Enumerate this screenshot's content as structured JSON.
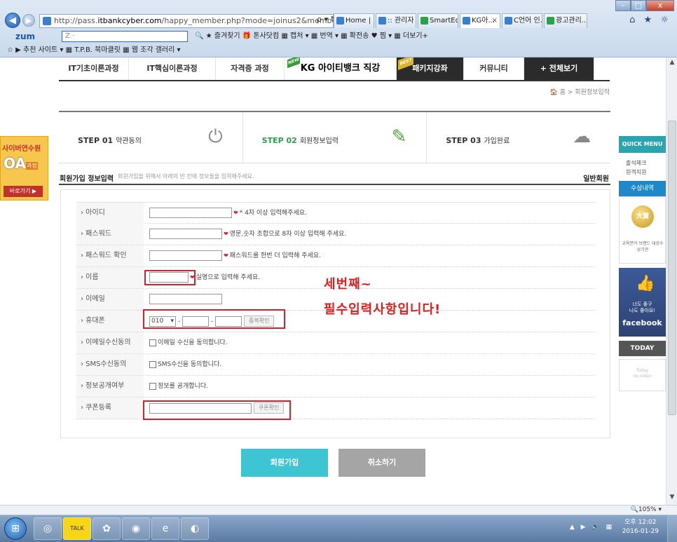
{
  "browser": {
    "url_prefix": "http://pass.",
    "url_host": "itbankcyber.com",
    "url_path": "/happy_member.php?mode=joinus2&member_group=1",
    "addr_tools": "ρ ▾ ↻",
    "tabs": [
      {
        "label": "Home | L...",
        "color": "#3a7fd0",
        "active": false
      },
      {
        "label": ":: 관리자 ...",
        "color": "#3a7fd0",
        "active": false
      },
      {
        "label": "SmartEdit...",
        "color": "#2ea04a",
        "active": false
      },
      {
        "label": "KG아...",
        "color": "#3a7fd0",
        "active": true
      },
      {
        "label": "C언어 인...",
        "color": "#3a7fd0",
        "active": false
      },
      {
        "label": "광고관리...",
        "color": "#2ea04a",
        "active": false
      }
    ],
    "win_min": "–",
    "win_max": "□",
    "win_close": "x",
    "home_star_gear": "⌂ ★ ☼",
    "zum_label": "zum",
    "zum_search_placeholder": "Z ·",
    "toolbar_items": "🔍 ★ 즐겨찾기   🎁 톤사닷컴   ▦ 캡처 ▾   ▦ 번역 ▾   ▦ 확전송   ♥ 찜 ▾   ▦ 더보기+",
    "bookmarks": "☆ ▶ 추천 사이트 ▾   ▦ T.P.B. 북마클릿   ▦ 웹 조각 갤러리 ▾",
    "zoom": "🔍105%  ▾"
  },
  "nav": {
    "items": [
      {
        "label": "IT기초이론과정",
        "width": 100
      },
      {
        "label": "IT핵심이론과정",
        "width": 124
      },
      {
        "label": "자격증 과정",
        "width": 98
      },
      {
        "label": "KG 아이티뱅크 직강",
        "width": 160
      },
      {
        "label": "패키지강좌",
        "width": 96
      },
      {
        "label": "커뮤니티",
        "width": 86
      },
      {
        "label": "+ 전체보기",
        "width": 100
      }
    ],
    "new_badge": "NEW",
    "best_badge": "BEST"
  },
  "breadcrumb": "🏠 홈 > 회원정보입력",
  "steps": [
    {
      "num": "STEP 01",
      "name": "약관동의",
      "icon": "⏻",
      "active": false
    },
    {
      "num": "STEP 02",
      "name": "회원정보입력",
      "icon": "✎",
      "active": true
    },
    {
      "num": "STEP 03",
      "name": "가입완료",
      "icon": "☁",
      "active": false
    }
  ],
  "form": {
    "title": "회원가입 정보입력",
    "desc": "회원가입을 위해서 아래의 빈 칸에 정보들을 입력해주세요.",
    "member_type": "일반회원",
    "rows": {
      "id": {
        "label": "› 아이디",
        "hint": "* 4자 이상 입력해주세요."
      },
      "password": {
        "label": "› 패스워드",
        "hint": "영문,숫자 조합으로 8자 이상 입력해 주세요."
      },
      "password_confirm": {
        "label": "› 패스워드 확인",
        "hint": "패스워드를 한번 더 입력해 주세요."
      },
      "name": {
        "label": "› 이름",
        "hint": "실명으로 입력해 주세요."
      },
      "email": {
        "label": "› 이메일"
      },
      "phone": {
        "label": "› 휴대폰",
        "prefix": "010",
        "dash": "-",
        "check_button": "중복확인"
      },
      "email_agree": {
        "label": "› 이메일수신동의",
        "text": "이메일 수신을 동의합니다."
      },
      "sms_agree": {
        "label": "› SMS수신동의",
        "text": "SMS수신을 동의합니다."
      },
      "public_info": {
        "label": "› 정보공개여부",
        "text": "정보를 공개합니다."
      },
      "coupon": {
        "label": "› 쿠폰등록",
        "button": "쿠폰확인"
      }
    }
  },
  "annotation": {
    "line1": "세번째~",
    "line2": "필수입력사항입니다!"
  },
  "buttons": {
    "join": "회원가입",
    "cancel": "취소하기"
  },
  "left_banner": {
    "line1": "사이버연수원",
    "oa": "OA",
    "course": "과정",
    "go": "바로가기 ▶"
  },
  "quick_menu": {
    "head": "QUICK MENU",
    "link1": "출석체크",
    "link2": "원격지원",
    "awards_head": "수상내역",
    "medal": "大賞",
    "award_caption": "교육분야 브랜드 대상수상기관",
    "fb_line1": "너도 좋구",
    "fb_line2": "나도 좋아요!",
    "fb_brand": "facebook",
    "today_head": "TODAY",
    "today_line1": "Today",
    "today_line2": "no-video"
  },
  "taskbar": {
    "start_icon": "⊞",
    "apps": [
      "◎",
      "TALK",
      "✿",
      "◉",
      "e",
      "◐"
    ],
    "tray": "▲ ▶ 🔈 ▦",
    "time": "오후 12:02",
    "date": "2016-01-29"
  }
}
